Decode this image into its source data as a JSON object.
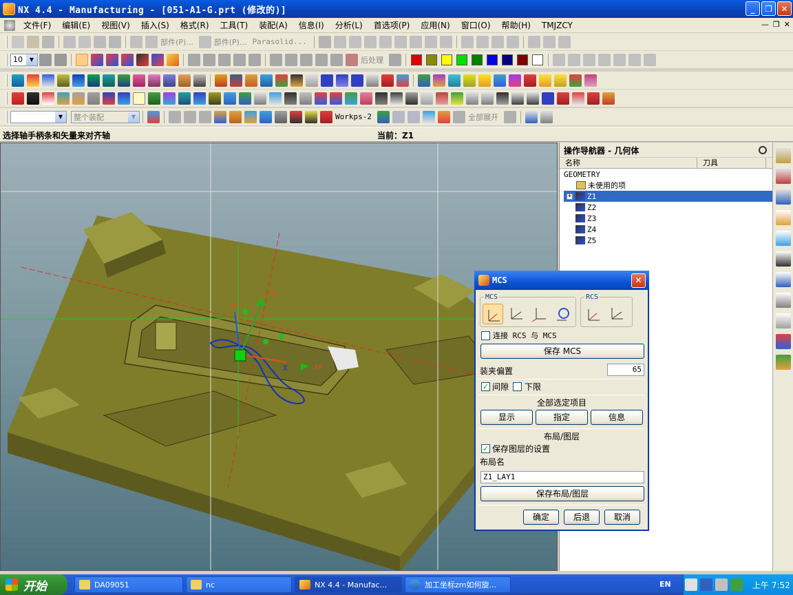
{
  "window": {
    "title": "NX 4.4 - Manufacturing - [051-A1-G.prt (修改的)]",
    "minimize": "_",
    "maximize": "❐",
    "close": "✕"
  },
  "menu": {
    "items": [
      "文件(F)",
      "编辑(E)",
      "视图(V)",
      "插入(S)",
      "格式(R)",
      "工具(T)",
      "装配(A)",
      "信息(I)",
      "分析(L)",
      "首选项(P)",
      "应用(N)",
      "窗口(O)",
      "帮助(H)",
      "TMJZCY"
    ]
  },
  "toolbars": {
    "row1": {
      "part_label": "部件(P)...",
      "part_label2": "部件(P)...",
      "parasolid_label": "Parasolid..."
    },
    "row2": {
      "snap_value": "10",
      "postprocess_label": "后处理",
      "colors": [
        "#e00000",
        "#8a8a00",
        "#ffff00",
        "#00e000",
        "#008000",
        "#0000e0",
        "#000080",
        "#800000",
        "#ffffff"
      ]
    },
    "row5": {
      "assembly_filter": "整个装配",
      "workps_label": "Workps-2",
      "expand_all_label": "全部展开"
    }
  },
  "status": {
    "prompt": "选择轴手柄条和矢量来对齐轴",
    "current": "当前：Z1"
  },
  "navigator": {
    "title": "操作导航器 - 几何体",
    "columns": {
      "name": "名称",
      "tool": "刀具"
    },
    "root": "GEOMETRY",
    "unused": "未使用的项",
    "items": [
      "Z1",
      "Z2",
      "Z3",
      "Z4",
      "Z5"
    ],
    "selected": "Z1"
  },
  "dialog": {
    "title": "MCS",
    "mcs_group_label": "MCS",
    "rcs_group_label": "RCS",
    "link_rcs_label": "连接 RCS 与 MCS",
    "link_rcs_checked": false,
    "save_mcs_button": "保存 MCS",
    "fixture_offset_label": "装夹偏置",
    "fixture_offset_value": "65",
    "clearance_label": "间隙",
    "clearance_checked": true,
    "lower_limit_label": "下限",
    "lower_limit_checked": false,
    "all_selected_label": "全部选定项目",
    "show_button": "显示",
    "specify_button": "指定",
    "info_button": "信息",
    "layout_layer_label": "布局/图层",
    "save_layer_settings_label": "保存图层的设置",
    "save_layer_settings_checked": true,
    "layout_name_label": "布局名",
    "layout_name_value": "Z1_LAY1",
    "save_layout_button": "保存布局/图层",
    "ok_button": "确定",
    "back_button": "后退",
    "cancel_button": "取消",
    "checkmark": "✓"
  },
  "taskbar": {
    "start_label": "开始",
    "tasks": [
      "DA09051",
      "nc",
      "NX 4.4 - Manufac...",
      "加工坐标zm如何旋..."
    ],
    "language": "EN",
    "clock": "上午 7:52"
  },
  "viewport": {
    "axis_labels": {
      "x_label": "X",
      "zc_label": "ZM",
      "yc_label": "YM",
      "xc_label": "XM"
    }
  }
}
